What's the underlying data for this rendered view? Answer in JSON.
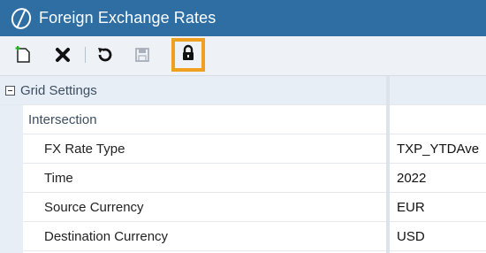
{
  "window": {
    "title": "Foreign Exchange Rates",
    "icon": "app-logo-icon"
  },
  "toolbar": {
    "buttons": [
      {
        "name": "new-icon"
      },
      {
        "name": "delete-icon"
      },
      {
        "name": "refresh-icon"
      },
      {
        "name": "save-icon"
      },
      {
        "name": "lock-icon",
        "highlighted": true,
        "highlight_color": "#f0a020"
      }
    ]
  },
  "grid": {
    "section_label": "Grid Settings",
    "subsection_label": "Intersection",
    "rows": [
      {
        "label": "FX Rate Type",
        "value": "TXP_YTDAve"
      },
      {
        "label": "Time",
        "value": "2022"
      },
      {
        "label": "Source Currency",
        "value": "EUR"
      },
      {
        "label": "Destination Currency",
        "value": "USD"
      }
    ]
  },
  "colors": {
    "titlebar": "#2e6ea3",
    "toolbar": "#eef2f7",
    "highlight": "#f0a020"
  }
}
